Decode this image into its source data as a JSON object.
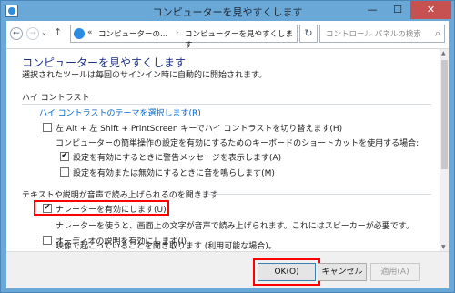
{
  "window": {
    "title": "コンピューターを見やすくします",
    "minimize_glyph": "—",
    "maximize_glyph": "☐",
    "close_glyph": "✕"
  },
  "navigation": {
    "back_glyph": "←",
    "forward_glyph": "→",
    "history_glyph": "⌄",
    "up_glyph": "↑",
    "refresh_glyph": "↻",
    "dropdown_glyph": "▾"
  },
  "address": {
    "sep0": "«",
    "crumb1": "コンピューターの...",
    "sep1": "›",
    "crumb2": "コンピューターを見やすくします"
  },
  "search": {
    "placeholder": "コントロール パネルの検索",
    "icon_glyph": "⌕"
  },
  "main": {
    "heading": "コンピューターを見やすくします",
    "description": "選択されたツールは毎回のサインイン時に自動的に開始されます。",
    "high_contrast": {
      "title": "ハイ コントラスト",
      "theme_link": "ハイ コントラストのテーマを選択します(R)",
      "toggle_hotkey": {
        "checked": false,
        "label": "左 Alt + 左 Shift + PrintScreen キーでハイ コントラストを切り替えます(H)"
      },
      "shortcut_note": "コンピューターの簡単操作の設定を有効にするためのキーボードのショートカットを使用する場合:",
      "warning_message": {
        "checked": true,
        "label": "設定を有効にするときに警告メッセージを表示します(A)"
      },
      "sound": {
        "checked": false,
        "label": "設定を有効または無効にするときに音を鳴らします(M)"
      }
    },
    "text_audio": {
      "title": "テキストや説明が音声で読み上げられるのを聞きます",
      "narrator": {
        "checked": true,
        "label": "ナレーターを有効にします(U)"
      },
      "narrator_note": "ナレーターを使うと、画面上の文字が音声で読み上げられます。これにはスピーカーが必要です。",
      "audio_description": {
        "checked": false,
        "label": "オーディオの説明を有効にします(I)"
      },
      "audio_description_note": "映像で起こっていることを聞き取ります (利用可能な場合)。"
    }
  },
  "buttons": {
    "ok": "OK(O)",
    "cancel": "キャンセル",
    "apply": "適用(A)"
  },
  "check_glyph": "✔",
  "colors": {
    "frame": "#6aa8d8",
    "heading": "#1e3287",
    "link": "#0066cc",
    "highlight": "#ff0000",
    "close_button": "#c75050"
  }
}
